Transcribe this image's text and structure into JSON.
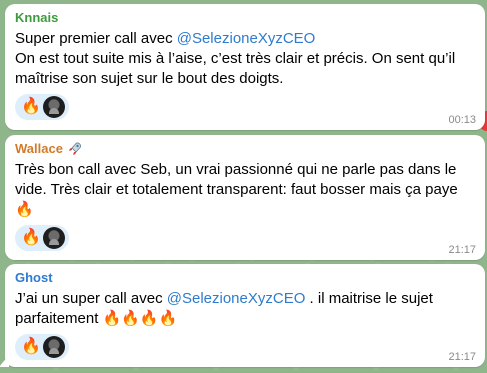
{
  "colors": {
    "background": "#8fb58b",
    "bubble": "#ffffff",
    "mention": "#2e7bcf",
    "reaction_pill": "#dfeefb",
    "time": "#8a8a8a"
  },
  "messages": [
    {
      "sender": "Knnais",
      "sender_color": "#3e9a3e",
      "text_parts": [
        "Super premier call avec ",
        "@SelezioneXyzCEO",
        "\nOn est tout suite mis à l’aise, c’est très clair et précis. On sent qu’il maîtrise son sujet sur le bout des doigts."
      ],
      "reactions": [
        "🔥",
        "avatar"
      ],
      "time": "00:13"
    },
    {
      "sender": "Wallace",
      "sender_badge": "rocket-icon",
      "sender_color": "#d27a2c",
      "text": "Très bon call avec Seb, un vrai passionné qui ne parle pas dans le vide. Très clair et totalement transparent: faut bosser mais ça paye 🔥",
      "reactions": [
        "🔥",
        "avatar"
      ],
      "time": "21:17"
    },
    {
      "sender": "Ghost",
      "sender_color": "#2e7bcf",
      "text_parts": [
        "J’ai un super  call avec ",
        "@SelezioneXyzCEO",
        "  .   il maitrise le sujet parfaitement 🔥🔥🔥🔥"
      ],
      "reactions": [
        "🔥",
        "avatar"
      ],
      "time": "21:17"
    }
  ]
}
